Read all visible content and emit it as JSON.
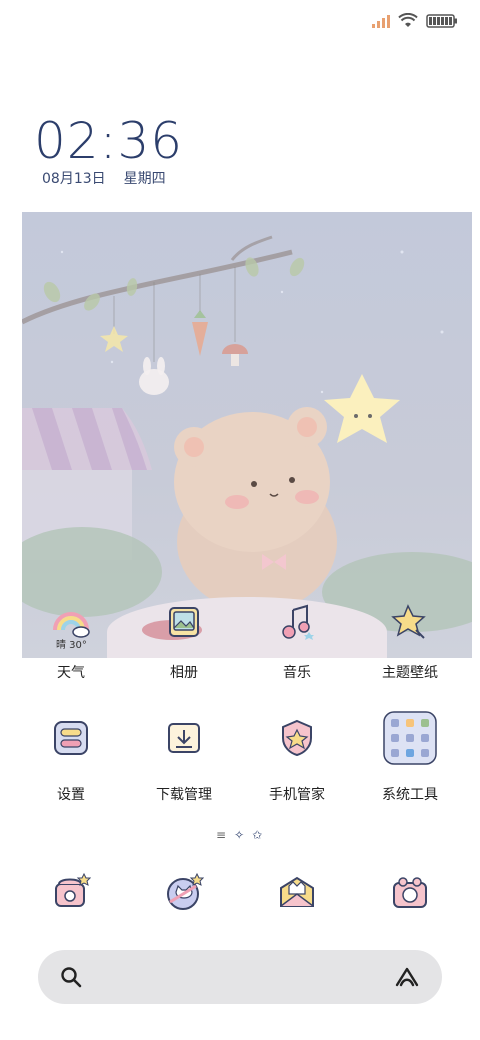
{
  "status_bar": {
    "icons": [
      "signal-icon",
      "wifi-icon",
      "battery-icon"
    ]
  },
  "clock": {
    "time": "02:36",
    "date": "08月13日",
    "weekday": "星期四"
  },
  "weather": {
    "condition": "晴",
    "temperature": "30°",
    "summary": "晴 30°"
  },
  "apps_row1": [
    {
      "label": "天气",
      "icon": "rainbow-weather-icon"
    },
    {
      "label": "相册",
      "icon": "photo-album-icon"
    },
    {
      "label": "音乐",
      "icon": "music-note-icon"
    },
    {
      "label": "主题壁纸",
      "icon": "star-wand-icon"
    }
  ],
  "apps_row2": [
    {
      "label": "设置",
      "icon": "toggle-settings-icon"
    },
    {
      "label": "下载管理",
      "icon": "download-box-icon"
    },
    {
      "label": "手机管家",
      "icon": "shield-star-icon"
    },
    {
      "label": "系统工具",
      "icon": "tools-folder-icon"
    }
  ],
  "page_indicator": {
    "glyphs": [
      "≡",
      "✧",
      "✩"
    ]
  },
  "dock": [
    {
      "icon": "phone-icon"
    },
    {
      "icon": "browser-cat-icon"
    },
    {
      "icon": "message-envelope-icon"
    },
    {
      "icon": "camera-bear-icon"
    }
  ],
  "search": {
    "placeholder": "",
    "left_icon": "search-icon",
    "right_icon": "assistant-icon"
  },
  "colors": {
    "clock": "#2c3e6b",
    "wallpaper_bg": "#c3c9da",
    "icon_outline": "#3b4466",
    "search_bg": "#e4e4e6"
  }
}
